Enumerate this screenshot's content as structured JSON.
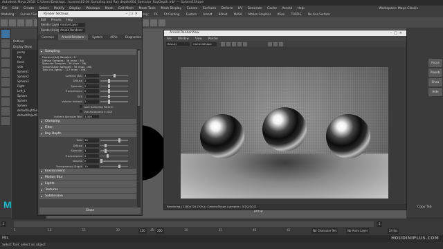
{
  "window": {
    "title": "Autodesk Maya 2016: C:\\Users\\Desktop\\...\\scenes\\02-04 Sampling and Ray depth\\004_Specular_RayDepth.mb* — Sphere1Shape",
    "menus": [
      "File",
      "Edit",
      "Create",
      "Select",
      "Modify",
      "Display",
      "Windows",
      "Mesh",
      "Edit Mesh",
      "Mesh Tools",
      "Mesh Display",
      "Curves",
      "Surfaces",
      "Deform",
      "UV",
      "Generate",
      "Cache",
      "Arnold",
      "Help"
    ],
    "workspace_label": "Workspace: Maya Classic"
  },
  "shelf": {
    "mode": "Modeling",
    "tabs": [
      "Curves / Surfaces",
      "Poly Modeling",
      "Sculpting",
      "Rigging",
      "Animation",
      "Rendering",
      "FX",
      "FX Caching",
      "Custom",
      "Arnold",
      "Bifrost",
      "MASH",
      "Motion Graphics",
      "XGen",
      "TURTLE"
    ],
    "live_surface": "No Live Surface"
  },
  "outliner": {
    "title": "Outliner",
    "menus": [
      "Display",
      "Show",
      "Help"
    ],
    "items": [
      "persp",
      "top",
      "front",
      "side",
      "Sphere1",
      "Sphere2",
      "Sphere3",
      "Right",
      "Left_L",
      "Sphere",
      "Sphere",
      "Sphere",
      "defaultLightSet",
      "defaultObjectSet"
    ]
  },
  "render_settings": {
    "title": "Render Settings",
    "menus": [
      "Edit",
      "Presets",
      "Help"
    ],
    "render_layer_label": "Render Layer",
    "render_layer_value": "masterLayer",
    "render_using_label": "Render Using",
    "render_using_value": "Arnold Renderer",
    "tabs": [
      "Common",
      "Arnold Renderer",
      "System",
      "AOVs",
      "Diagnostics"
    ],
    "active_tab": "Arnold Renderer",
    "sampling_section": "Sampling",
    "info_lines": [
      "Camera (AA) Samples : 9",
      "Diffuse Samples : 36 (max : 36)",
      "Specular Samples : 36 (max : 36)",
      "Transmission Samples : 36 (max : 36)",
      "Total (no lights) : 117 (max : 198)"
    ],
    "sampling_fields": [
      {
        "label": "Camera (AA)",
        "value": "3",
        "level": 0.5
      },
      {
        "label": "Diffuse",
        "value": "2",
        "level": 0.3
      },
      {
        "label": "Specular",
        "value": "2",
        "level": 0.3
      },
      {
        "label": "Transmission",
        "value": "2",
        "level": 0.3
      },
      {
        "label": "SSS",
        "value": "2",
        "level": 0.3
      },
      {
        "label": "Volume Indirect",
        "value": "2",
        "level": 0.3
      }
    ],
    "checkboxes": [
      "Lock Sampling Pattern",
      "Use Autobump in SSS"
    ],
    "indirect_specular_blur_label": "Indirect Specular Blur",
    "indirect_specular_blur_value": "1.000",
    "collapsed_sections_top": [
      "Clamping",
      "Filter"
    ],
    "ray_depth_section": "Ray Depth",
    "ray_depth_fields": [
      {
        "label": "Total",
        "value": "10",
        "level": 0.7
      },
      {
        "label": "Diffuse",
        "value": "1",
        "level": 0.15
      },
      {
        "label": "Specular",
        "value": "1",
        "level": 0.15
      },
      {
        "label": "Transmission",
        "value": "2",
        "level": 0.25
      },
      {
        "label": "Volume",
        "value": "0",
        "level": 0.0
      },
      {
        "label": "Transparency Depth",
        "value": "10",
        "level": 0.7
      }
    ],
    "collapsed_sections_bottom": [
      "Environment",
      "Motion Blur",
      "Lights",
      "Textures",
      "Subdivision"
    ],
    "close_label": "Close"
  },
  "render_view": {
    "title": "Arnold RenderView",
    "menus": [
      "File",
      "Window",
      "View",
      "Render"
    ],
    "channel_value": "Beauty",
    "camera_value": "CameraShape",
    "status_text": "Rendering  |  1280x720 (70%)  |  CameraShape  |  samples : 3/2/2/2/2/2",
    "bottom_tab": "Camera"
  },
  "viewport": {
    "camera_label": "persp"
  },
  "right_panel": {
    "buttons": [
      "Focus",
      "Presets",
      "Show",
      "Hide"
    ],
    "select_label": "Select",
    "load_attributes_label": "Load Attributes",
    "copy_tab_label": "Copy Tab"
  },
  "timeline": {
    "ticks": [
      "5",
      "10",
      "15",
      "20",
      "25",
      "30",
      "35",
      "40",
      "45",
      "50"
    ],
    "start": "1",
    "end": "120",
    "range_end": "200",
    "current": "1",
    "character_set": "No Character Set",
    "anim_layer": "No Anim Layer",
    "fps": "24 fps"
  },
  "command_line": {
    "lang": "MEL",
    "help": "Select Tool: select an object"
  },
  "brand": {
    "maya_letter": "M",
    "watermark": "HOUDINIPLUS.COM"
  }
}
